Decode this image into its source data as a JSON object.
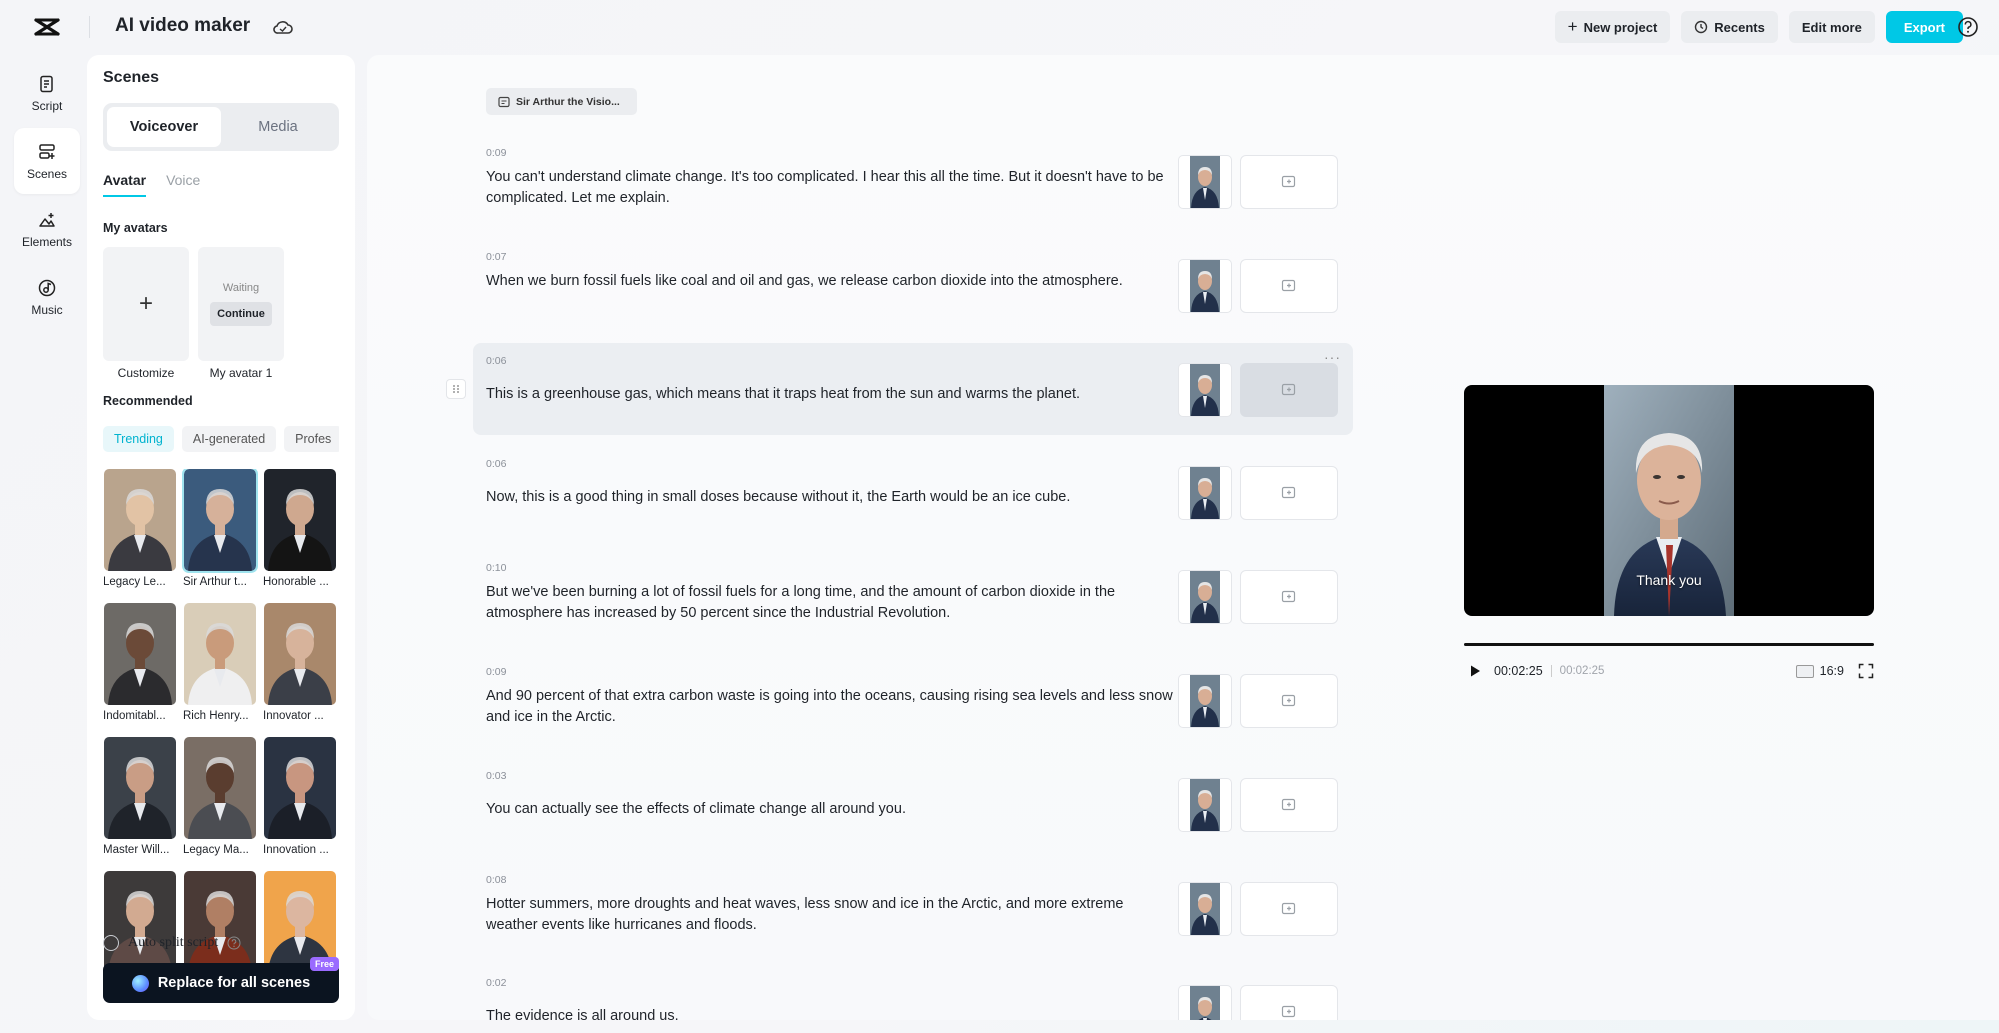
{
  "header": {
    "title": "AI video maker",
    "buttons": {
      "new_project": "New project",
      "recents": "Recents",
      "edit_more": "Edit more",
      "export": "Export"
    }
  },
  "rail": [
    {
      "label": "Script",
      "icon": "script-icon"
    },
    {
      "label": "Scenes",
      "icon": "scenes-icon"
    },
    {
      "label": "Elements",
      "icon": "elements-icon"
    },
    {
      "label": "Music",
      "icon": "music-icon"
    }
  ],
  "scenes_panel": {
    "title": "Scenes",
    "segments": [
      "Voiceover",
      "Media"
    ],
    "subtabs": [
      "Avatar",
      "Voice"
    ],
    "my_avatars_label": "My avatars",
    "customize_label": "Customize",
    "my_avatar": {
      "name": "My avatar 1",
      "status": "Waiting",
      "action": "Continue"
    },
    "recommended_label": "Recommended",
    "chips": [
      "Trending",
      "AI-generated",
      "Profes"
    ],
    "avatars": [
      "Legacy Le...",
      "Sir Arthur t...",
      "Honorable ...",
      "Indomitabl...",
      "Rich Henry...",
      "Innovator ...",
      "Master Will...",
      "Legacy Ma...",
      "Innovation ...",
      "",
      "",
      ""
    ],
    "auto_split_label": "Auto split script",
    "replace_button": "Replace for all scenes",
    "free_badge": "Free"
  },
  "script": {
    "voice_chip": "Sir Arthur the Visio...",
    "scenes": [
      {
        "time": "0:09",
        "text": "You can't understand climate change. It's too complicated. I hear this all the time. But it doesn't have to be complicated. Let me explain."
      },
      {
        "time": "0:07",
        "text": "When we burn fossil fuels like coal and oil and gas, we release carbon dioxide into the atmosphere."
      },
      {
        "time": "0:06",
        "text": "This is a greenhouse gas, which means that it traps heat from the sun and warms the planet."
      },
      {
        "time": "0:06",
        "text": "Now, this is a good thing in small doses because without it, the Earth would be an ice cube."
      },
      {
        "time": "0:10",
        "text": "But we've been burning a lot of fossil fuels for a long time, and the amount of carbon dioxide in the atmosphere has increased by 50 percent since the Industrial Revolution."
      },
      {
        "time": "0:09",
        "text": "And 90 percent of that extra carbon waste is going into the oceans, causing rising sea levels and less snow and ice in the Arctic."
      },
      {
        "time": "0:03",
        "text": "You can actually see the effects of climate change all around you."
      },
      {
        "time": "0:08",
        "text": "Hotter summers, more droughts and heat waves, less snow and ice in the Arctic, and more extreme weather events like hurricanes and floods."
      },
      {
        "time": "0:02",
        "text": "The evidence is all around us."
      }
    ],
    "more_label": "···"
  },
  "preview": {
    "subtitle": "Thank you",
    "current_time": "00:02:25",
    "total_time": "00:02:25",
    "aspect_ratio": "16:9"
  },
  "colors": {
    "accent": "#00c8e6",
    "dark_button": "#0b1420",
    "badge": "#9a6bff"
  }
}
